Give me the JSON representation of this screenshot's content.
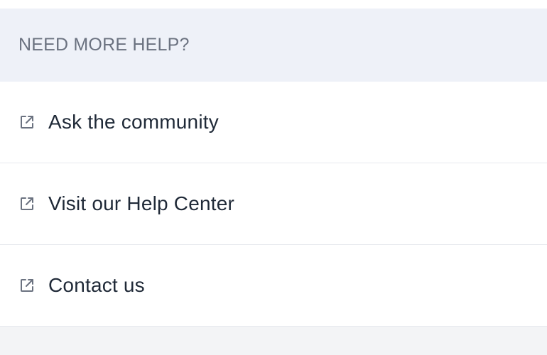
{
  "help": {
    "title": "NEED MORE HELP?",
    "items": [
      {
        "label": "Ask the community",
        "icon": "external-link-icon"
      },
      {
        "label": "Visit our Help Center",
        "icon": "external-link-icon"
      },
      {
        "label": "Contact us",
        "icon": "external-link-icon"
      }
    ]
  },
  "colors": {
    "header_bg": "#eef1f8",
    "header_text": "#6b7280",
    "item_text": "#1f2937",
    "icon": "#6b7280",
    "divider": "#e7e9ee",
    "page_bg": "#f3f4f6"
  }
}
